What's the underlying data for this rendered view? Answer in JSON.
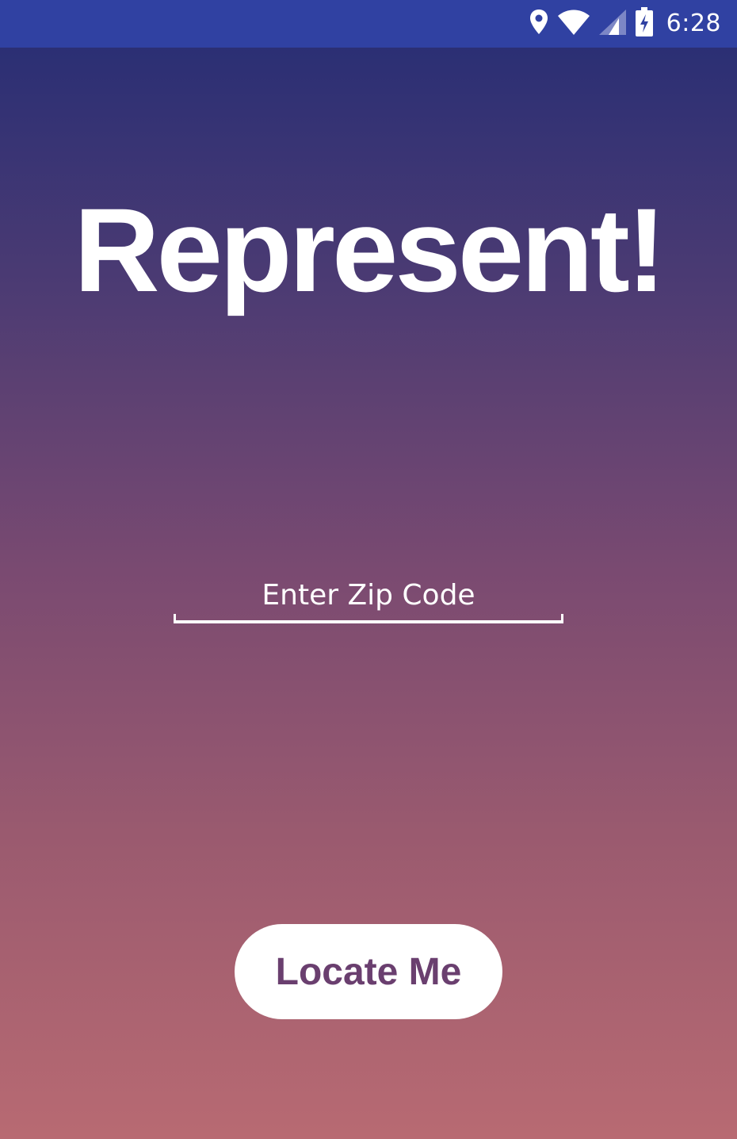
{
  "status_bar": {
    "time": "6:28",
    "icons": [
      "location-icon",
      "wifi-icon",
      "signal-icon",
      "battery-charging-icon"
    ]
  },
  "app": {
    "title": "Represent!"
  },
  "zip_field": {
    "placeholder": "Enter Zip Code",
    "value": ""
  },
  "locate_button": {
    "label": "Locate Me"
  },
  "colors": {
    "status_bar": "#3041a2",
    "gradient_top": "#2b2f74",
    "gradient_bottom": "#b86a72",
    "button_text": "#6a3f6f"
  }
}
